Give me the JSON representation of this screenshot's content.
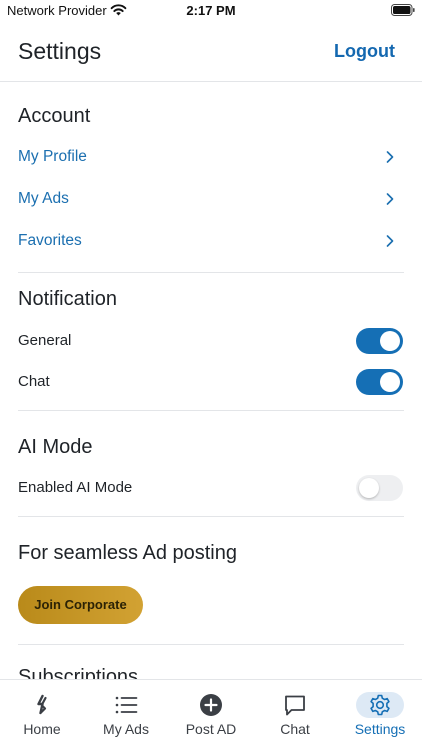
{
  "status_bar": {
    "carrier": "Network Provider",
    "time": "2:17 PM"
  },
  "header": {
    "title": "Settings",
    "logout_label": "Logout"
  },
  "account": {
    "title": "Account",
    "items": [
      {
        "label": "My Profile"
      },
      {
        "label": "My Ads"
      },
      {
        "label": "Favorites"
      }
    ]
  },
  "notification": {
    "title": "Notification",
    "items": [
      {
        "label": "General",
        "enabled": true
      },
      {
        "label": "Chat",
        "enabled": true
      }
    ]
  },
  "ai_mode": {
    "title": "AI Mode",
    "items": [
      {
        "label": "Enabled AI Mode",
        "enabled": false
      }
    ]
  },
  "corporate": {
    "title": "For seamless Ad posting",
    "button_label": "Join Corporate"
  },
  "subscriptions": {
    "title": "Subscriptions"
  },
  "tab_bar": {
    "tabs": [
      {
        "label": "Home",
        "icon": "home-logo-icon",
        "active": false
      },
      {
        "label": "My Ads",
        "icon": "list-icon",
        "active": false
      },
      {
        "label": "Post AD",
        "icon": "plus-circle-icon",
        "active": false
      },
      {
        "label": "Chat",
        "icon": "chat-bubble-icon",
        "active": false
      },
      {
        "label": "Settings",
        "icon": "gear-icon",
        "active": true
      }
    ]
  },
  "colors": {
    "accent": "#156fb5",
    "link": "#1b6fb0",
    "corporate_button": "#c4961f"
  }
}
